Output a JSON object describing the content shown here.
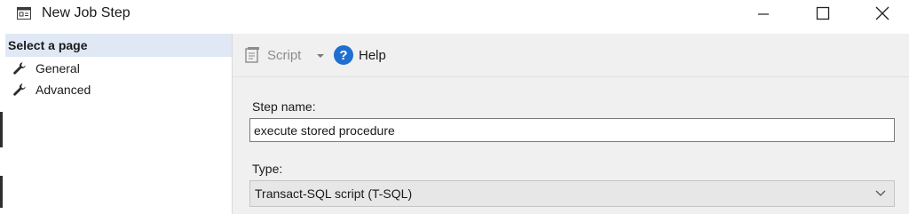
{
  "window": {
    "title": "New Job Step",
    "icon": "window-icon",
    "controls": [
      "minimize-icon",
      "maximize-icon",
      "close-icon"
    ]
  },
  "sidebar": {
    "header": "Select a page",
    "items": [
      {
        "label": "General",
        "icon": "wrench-icon",
        "selected": true
      },
      {
        "label": "Advanced",
        "icon": "wrench-icon",
        "selected": false
      }
    ]
  },
  "toolbar": {
    "script_label": "Script",
    "script_enabled": false,
    "help_label": "Help"
  },
  "form": {
    "step_name_label": "Step name:",
    "step_name_value": "execute stored procedure",
    "type_label": "Type:",
    "type_value": "Transact-SQL script (T-SQL)"
  },
  "colors": {
    "header_bg": "#dfe8f4",
    "panel_bg": "#f0f0f0",
    "help_blue": "#1f6fd0"
  }
}
